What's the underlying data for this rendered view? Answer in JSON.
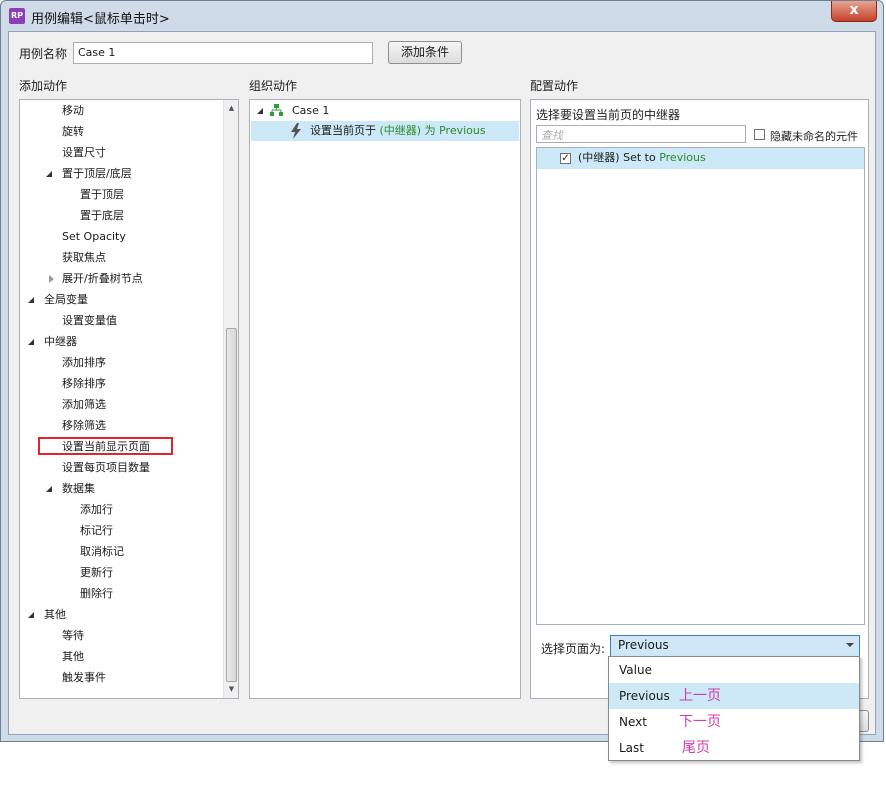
{
  "window": {
    "title": "用例编辑<鼠标单击时>",
    "app_icon": "RP",
    "close": "x"
  },
  "case_name": {
    "label": "用例名称",
    "value": "Case 1",
    "add_condition": "添加条件"
  },
  "sections": {
    "add_action": "添加动作",
    "organize_action": "组织动作",
    "configure_action": "配置动作"
  },
  "actions_tree": [
    {
      "label": "移动"
    },
    {
      "label": "旋转"
    },
    {
      "label": "设置尺寸"
    },
    {
      "label": "置于顶层/底层"
    },
    {
      "label": "置于顶层"
    },
    {
      "label": "置于底层"
    },
    {
      "label": "Set Opacity"
    },
    {
      "label": "获取焦点"
    },
    {
      "label": "展开/折叠树节点"
    },
    {
      "label": "全局变量"
    },
    {
      "label": "设置变量值"
    },
    {
      "label": "中继器"
    },
    {
      "label": "添加排序"
    },
    {
      "label": "移除排序"
    },
    {
      "label": "添加筛选"
    },
    {
      "label": "移除筛选"
    },
    {
      "label": "设置当前显示页面"
    },
    {
      "label": "设置每页项目数量"
    },
    {
      "label": "数据集"
    },
    {
      "label": "添加行"
    },
    {
      "label": "标记行"
    },
    {
      "label": "取消标记"
    },
    {
      "label": "更新行"
    },
    {
      "label": "删除行"
    },
    {
      "label": "其他"
    },
    {
      "label": "等待"
    },
    {
      "label": "其他"
    },
    {
      "label": "触发事件"
    }
  ],
  "organize": {
    "case": "Case 1",
    "action_prefix": "设置当前页于",
    "action_target": "(中继器)",
    "action_mid": "为",
    "action_value": "Previous"
  },
  "configure": {
    "heading": "选择要设置当前页的中继器",
    "search_placeholder": "查找",
    "hide_unnamed": "隐藏未命名的元件",
    "item_check": "✓",
    "item_target": "(中继器)",
    "item_mid": "Set to",
    "item_value": "Previous",
    "select_label": "选择页面为:",
    "select_value": "Previous",
    "options": [
      {
        "label": "Value",
        "note": ""
      },
      {
        "label": "Previous",
        "note": "上一页"
      },
      {
        "label": "Next",
        "note": "下一页"
      },
      {
        "label": "Last",
        "note": "尾页"
      }
    ]
  },
  "colors": {
    "accent_green": "#2a8a2a",
    "annotation": "#d63aa8",
    "selection": "#cde8f7",
    "highlight_box": "#e0262b"
  },
  "icons": {
    "case": "case-tree-icon",
    "action": "lightning-icon",
    "dropdown": "chevron-down-icon"
  }
}
